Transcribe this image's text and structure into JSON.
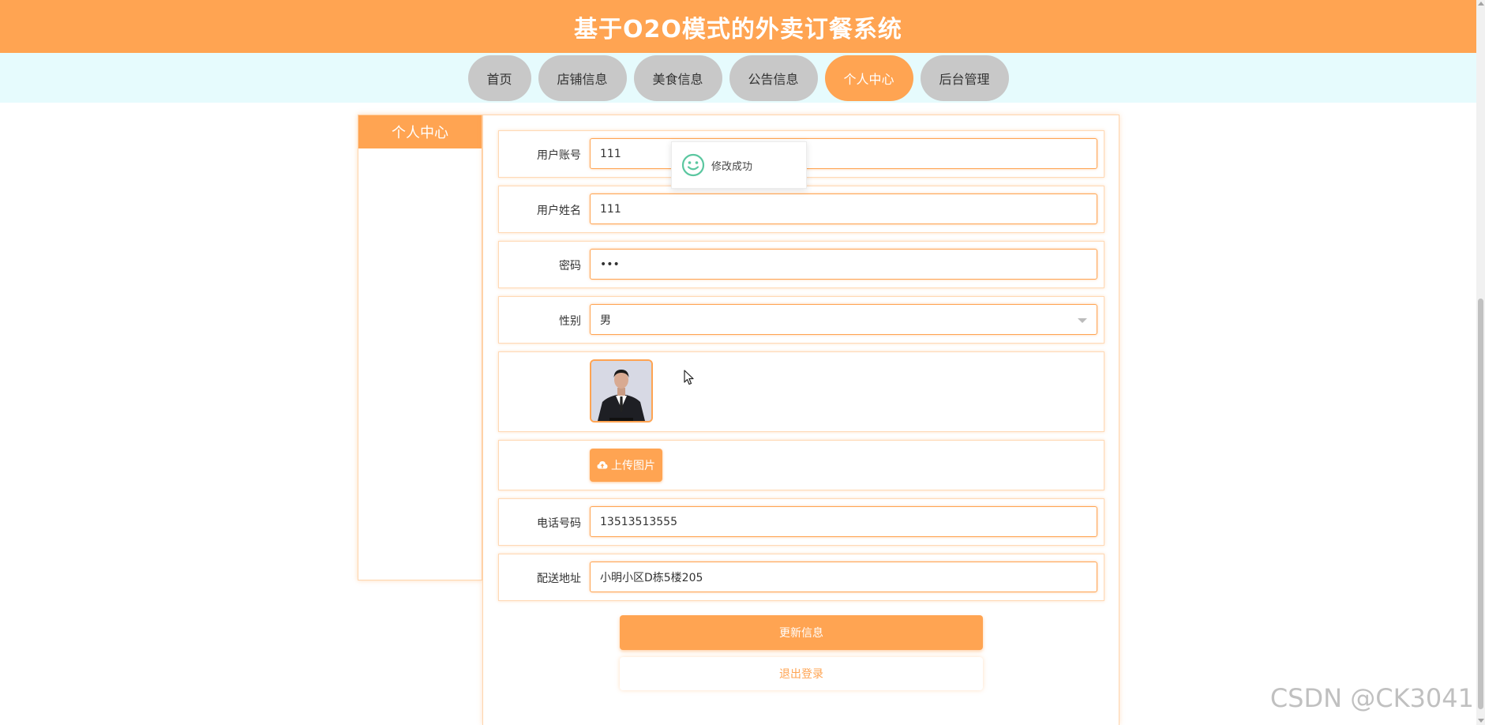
{
  "header": {
    "title": "基于O2O模式的外卖订餐系统"
  },
  "nav": {
    "items": [
      {
        "label": "首页"
      },
      {
        "label": "店铺信息"
      },
      {
        "label": "美食信息"
      },
      {
        "label": "公告信息"
      },
      {
        "label": "个人中心",
        "active": true
      },
      {
        "label": "后台管理"
      }
    ]
  },
  "sidebar": {
    "title": "个人中心"
  },
  "form": {
    "account": {
      "label": "用户账号",
      "value": "111"
    },
    "name": {
      "label": "用户姓名",
      "value": "111"
    },
    "password": {
      "label": "密码",
      "value": "•••"
    },
    "gender": {
      "label": "性别",
      "value": "男"
    },
    "upload_label": "上传图片",
    "phone": {
      "label": "电话号码",
      "value": "13513513555"
    },
    "address": {
      "label": "配送地址",
      "value": "小明小区D栋5楼205"
    },
    "update_label": "更新信息",
    "logout_label": "退出登录"
  },
  "toast": {
    "message": "修改成功"
  },
  "watermark": "CSDN @CK3041",
  "colors": {
    "accent": "#ffa452",
    "nav_bg": "#e6fbfd",
    "nav_item": "#c8c8c8",
    "success": "#5bc7a0"
  }
}
